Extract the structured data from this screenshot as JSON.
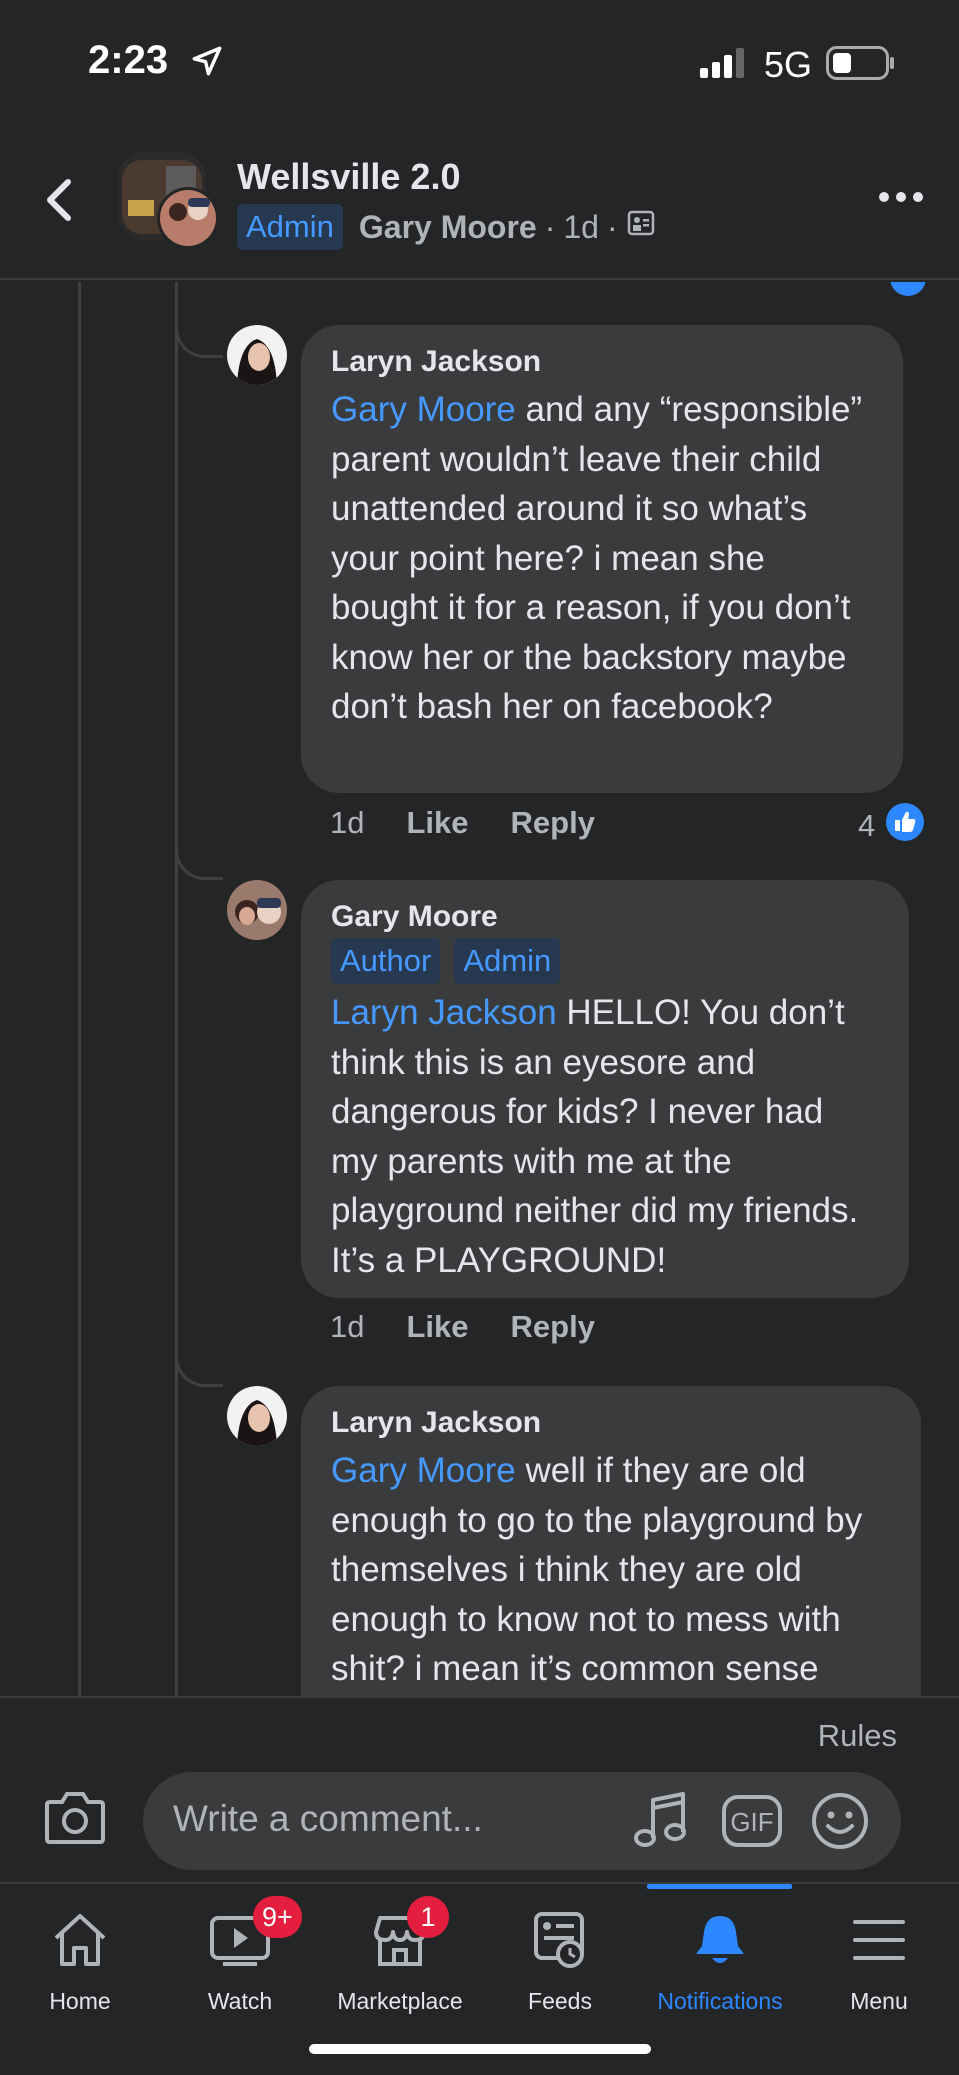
{
  "status_bar": {
    "time": "2:23",
    "network": "5G"
  },
  "header": {
    "group_name": "Wellsville 2.0",
    "role_badge": "Admin",
    "author": "Gary Moore",
    "dot": "·",
    "age": "1d"
  },
  "comments": [
    {
      "author": "Laryn Jackson",
      "mention": "Gary Moore",
      "text": " and any “responsible” parent wouldn’t leave their child unattended around it so what’s your point here? i mean she bought it for a reason, if you don’t know her or the backstory maybe don’t bash her on facebook?",
      "time": "1d",
      "like_label": "Like",
      "reply_label": "Reply",
      "reaction_count": "4"
    },
    {
      "author": "Gary Moore",
      "badges": [
        "Author",
        "Admin"
      ],
      "mention": "Laryn Jackson",
      "text": " HELLO! You don’t think this is an eyesore and dangerous for kids? I never had my parents with me at the playground neither did my friends. It’s a PLAYGROUND!",
      "time": "1d",
      "like_label": "Like",
      "reply_label": "Reply"
    },
    {
      "author": "Laryn Jackson",
      "mention": "Gary Moore",
      "text": " well if they are old enough to go to the playground by themselves i think they are old enough to know not to mess with shit? i mean it’s common sense"
    }
  ],
  "composer": {
    "rules_label": "Rules",
    "placeholder": "Write a comment...",
    "gif_label": "GIF"
  },
  "tabs": [
    {
      "label": "Home",
      "icon": "home-icon"
    },
    {
      "label": "Watch",
      "icon": "watch-icon",
      "badge": "9+"
    },
    {
      "label": "Marketplace",
      "icon": "marketplace-icon",
      "badge": "1"
    },
    {
      "label": "Feeds",
      "icon": "feeds-icon"
    },
    {
      "label": "Notifications",
      "icon": "bell-icon",
      "active": true
    },
    {
      "label": "Menu",
      "icon": "menu-icon"
    }
  ],
  "colors": {
    "background": "#242526",
    "bubble": "#3a3b3c",
    "link_blue": "#4599ff",
    "active_blue": "#2d88ff",
    "badge_red": "#e41e3f"
  }
}
